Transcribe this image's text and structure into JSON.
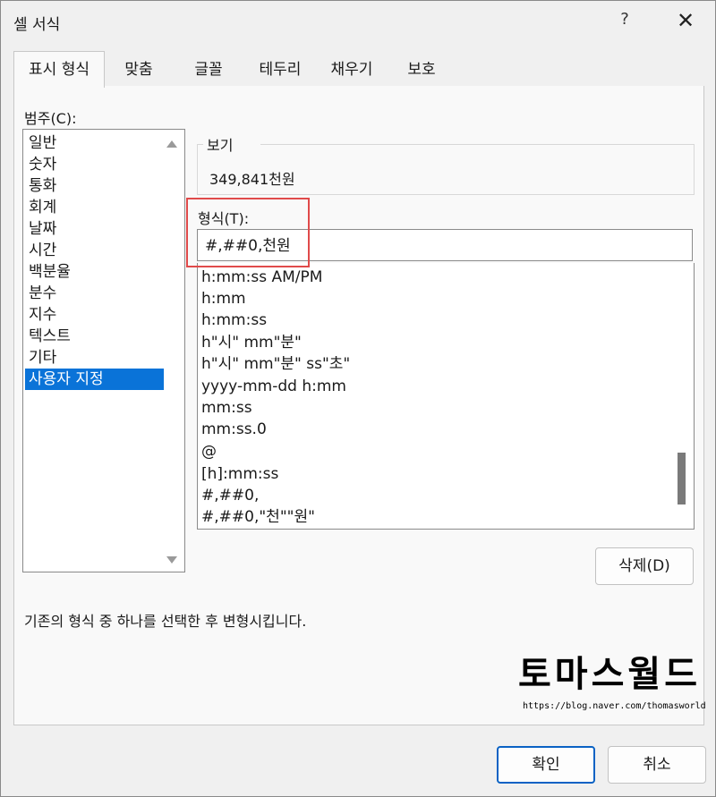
{
  "window": {
    "title": "셀 서식",
    "help_label": "?",
    "close_label": "✕"
  },
  "tabs": [
    {
      "label": "표시 형식",
      "active": true
    },
    {
      "label": "맞춤"
    },
    {
      "label": "글꼴"
    },
    {
      "label": "테두리"
    },
    {
      "label": "채우기"
    },
    {
      "label": "보호"
    }
  ],
  "category": {
    "label": "범주(C):",
    "items": [
      "일반",
      "숫자",
      "통화",
      "회계",
      "날짜",
      "시간",
      "백분율",
      "분수",
      "지수",
      "텍스트",
      "기타",
      "사용자 지정"
    ],
    "selected": "사용자 지정"
  },
  "sample": {
    "label": "보기",
    "value": "349,841천원"
  },
  "format": {
    "label": "형식(T):",
    "value": "#,##0,천원",
    "list": [
      "h:mm:ss AM/PM",
      "h:mm",
      "h:mm:ss",
      "h\"시\" mm\"분\"",
      "h\"시\" mm\"분\" ss\"초\"",
      "yyyy-mm-dd h:mm",
      "mm:ss",
      "mm:ss.0",
      "@",
      "[h]:mm:ss",
      "#,##0,",
      "#,##0,\"천\"\"원\""
    ]
  },
  "delete_button": "삭제(D)",
  "description": "기존의 형식 중 하나를 선택한 후 변형시킵니다.",
  "watermark": {
    "text": "토마스월드",
    "url": "https://blog.naver.com/thomasworld"
  },
  "footer": {
    "ok": "확인",
    "cancel": "취소"
  },
  "colors": {
    "selection": "#0a73d8",
    "highlight_box": "#e04a4a",
    "primary_border": "#0a62c4"
  }
}
